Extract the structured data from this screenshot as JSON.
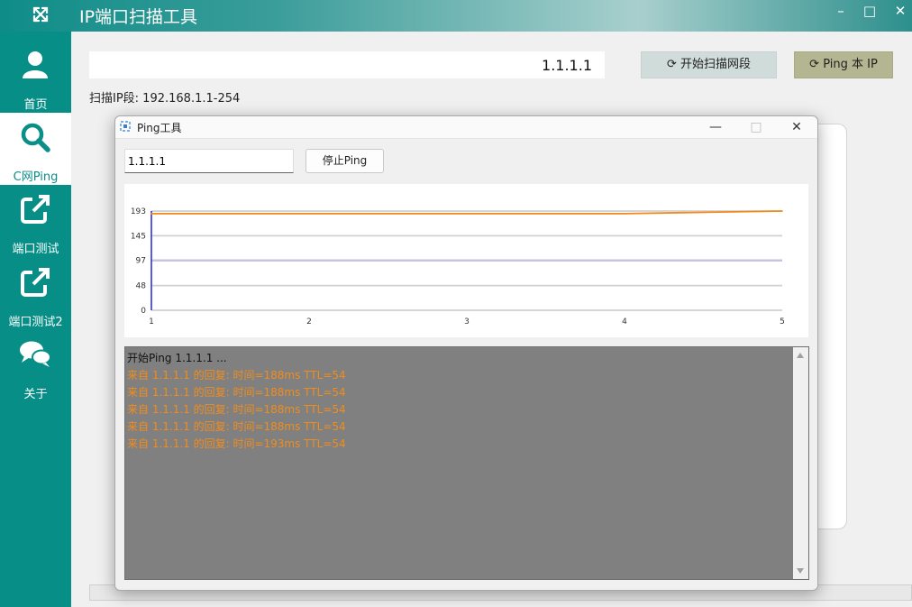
{
  "app": {
    "title": "IP端口扫描工具",
    "logo_icon": "expand-arrows-icon"
  },
  "window_controls": {
    "minimize": "–",
    "maximize": "□",
    "close": "✕"
  },
  "sidebar": {
    "items": [
      {
        "label": "首页",
        "icon": "user-icon",
        "active": false
      },
      {
        "label": "C网Ping",
        "icon": "search-icon",
        "active": true
      },
      {
        "label": "端口测试",
        "icon": "external-link-icon",
        "active": false
      },
      {
        "label": "端口测试2",
        "icon": "external-link-icon",
        "active": false
      },
      {
        "label": "关于",
        "icon": "chat-bubbles-icon",
        "active": false
      }
    ]
  },
  "main": {
    "ip_value": "1.1.1.1",
    "scan_button_label": "开始扫描网段",
    "ping_button_label": "Ping 本 IP",
    "scan_range_text": "扫描IP段: 192.168.1.1-254"
  },
  "dialog": {
    "title": "Ping工具",
    "ip_value": "1.1.1.1",
    "stop_button_label": "停止Ping",
    "controls": {
      "minimize": "—",
      "maximize": "□",
      "close": "✕"
    }
  },
  "chart_data": {
    "type": "line",
    "x": [
      1,
      2,
      3,
      4,
      5
    ],
    "series": [
      {
        "values": [
          188,
          188,
          188,
          188,
          193
        ],
        "color": "#f08c1e"
      }
    ],
    "yticks": [
      0,
      48,
      97,
      145,
      193
    ],
    "xticks": [
      1,
      2,
      3,
      4,
      5
    ],
    "ylim": [
      0,
      193
    ],
    "xlim": [
      1,
      5
    ],
    "grid": true
  },
  "log": {
    "lines": [
      {
        "text": "开始Ping 1.1.1.1 ...",
        "color": "#111111"
      },
      {
        "text": "来自 1.1.1.1 的回复: 时间=188ms TTL=54",
        "color": "#f08c1e"
      },
      {
        "text": "来自 1.1.1.1 的回复: 时间=188ms TTL=54",
        "color": "#f08c1e"
      },
      {
        "text": "来自 1.1.1.1 的回复: 时间=188ms TTL=54",
        "color": "#f08c1e"
      },
      {
        "text": "来自 1.1.1.1 的回复: 时间=188ms TTL=54",
        "color": "#f08c1e"
      },
      {
        "text": "来自 1.1.1.1 的回复: 时间=193ms TTL=54",
        "color": "#f08c1e"
      }
    ]
  },
  "colors": {
    "accent": "#078e87",
    "scan_button": "#d0dcda",
    "ping_button": "#b4b591",
    "log_bg": "#808080",
    "log_reply": "#f08c1e"
  }
}
